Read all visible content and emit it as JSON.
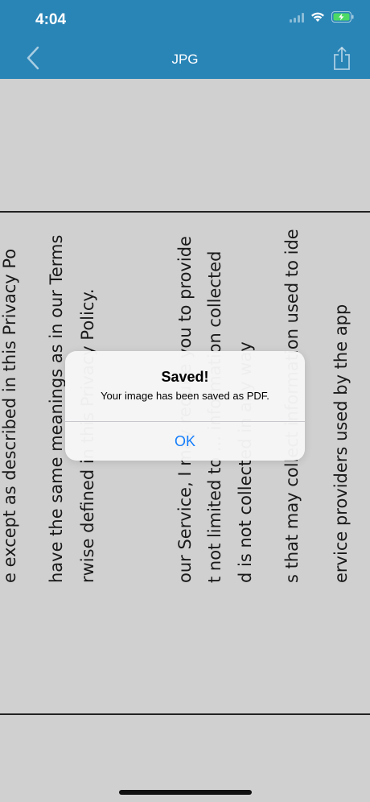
{
  "status_bar": {
    "time": "4:04",
    "icons": [
      "signal-icon",
      "wifi-icon",
      "battery-charging-icon"
    ]
  },
  "nav": {
    "title": "JPG",
    "back_icon": "chevron-left-icon",
    "share_icon": "share-icon"
  },
  "document": {
    "lines": [
      "e except as described in this Privacy Po",
      "have the same meanings as in our Terms",
      "rwise defined in this Privacy Policy.",
      "our Service, I may require you to provide",
      "t not limited to ... information collected",
      "d is not collected in any way",
      "s that may collect information used to ide",
      "ervice providers used by the app"
    ]
  },
  "alert": {
    "title": "Saved!",
    "message": "Your image has been saved as PDF.",
    "ok_label": "OK"
  },
  "colors": {
    "header": "#2a85b7",
    "background": "#d0d0d0",
    "alert_button": "#147efb"
  }
}
